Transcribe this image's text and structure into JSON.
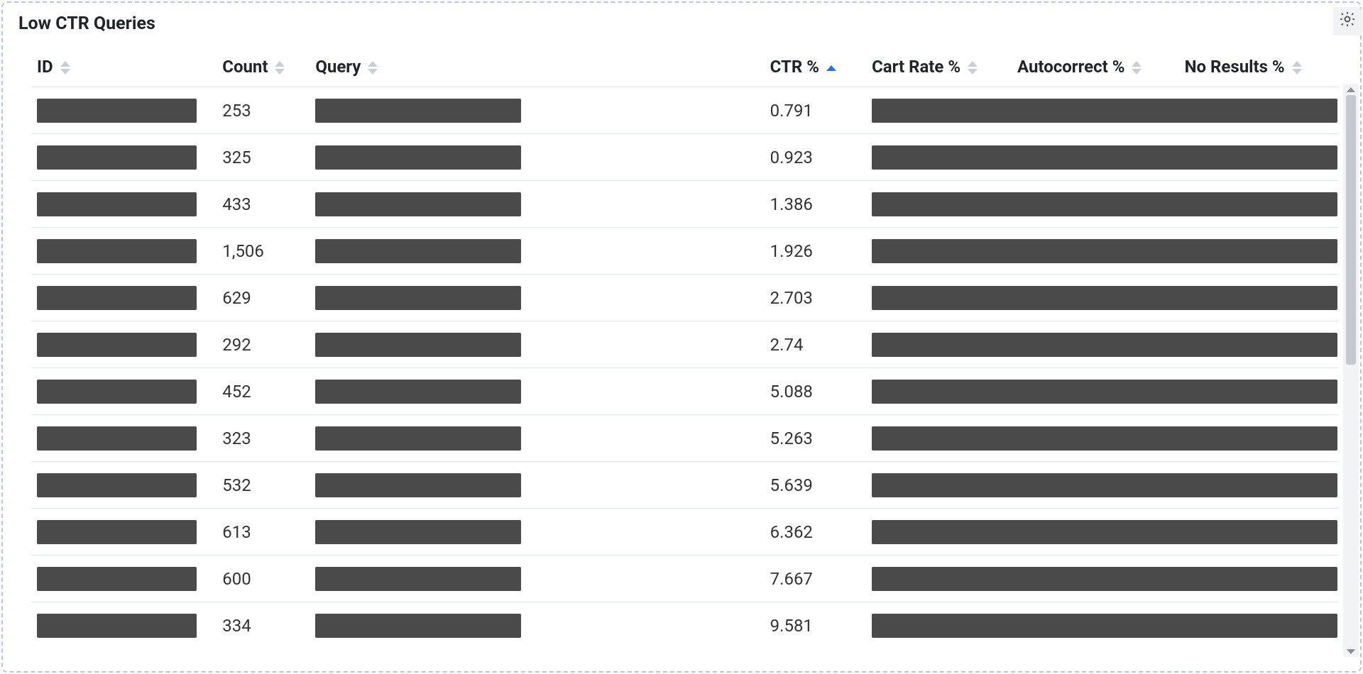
{
  "panel": {
    "title": "Low CTR Queries"
  },
  "table": {
    "columns": {
      "id": {
        "label": "ID",
        "sort": "both"
      },
      "count": {
        "label": "Count",
        "sort": "both"
      },
      "query": {
        "label": "Query",
        "sort": "both"
      },
      "ctr": {
        "label": "CTR %",
        "sort": "asc-active"
      },
      "cart": {
        "label": "Cart Rate %",
        "sort": "both"
      },
      "auto": {
        "label": "Autocorrect %",
        "sort": "both"
      },
      "nores": {
        "label": "No Results %",
        "sort": "both"
      }
    },
    "rows": [
      {
        "count": "253",
        "ctr": "0.791"
      },
      {
        "count": "325",
        "ctr": "0.923"
      },
      {
        "count": "433",
        "ctr": "1.386"
      },
      {
        "count": "1,506",
        "ctr": "1.926"
      },
      {
        "count": "629",
        "ctr": "2.703"
      },
      {
        "count": "292",
        "ctr": "2.74"
      },
      {
        "count": "452",
        "ctr": "5.088"
      },
      {
        "count": "323",
        "ctr": "5.263"
      },
      {
        "count": "532",
        "ctr": "5.639"
      },
      {
        "count": "613",
        "ctr": "6.362"
      },
      {
        "count": "600",
        "ctr": "7.667"
      },
      {
        "count": "334",
        "ctr": "9.581"
      }
    ]
  }
}
